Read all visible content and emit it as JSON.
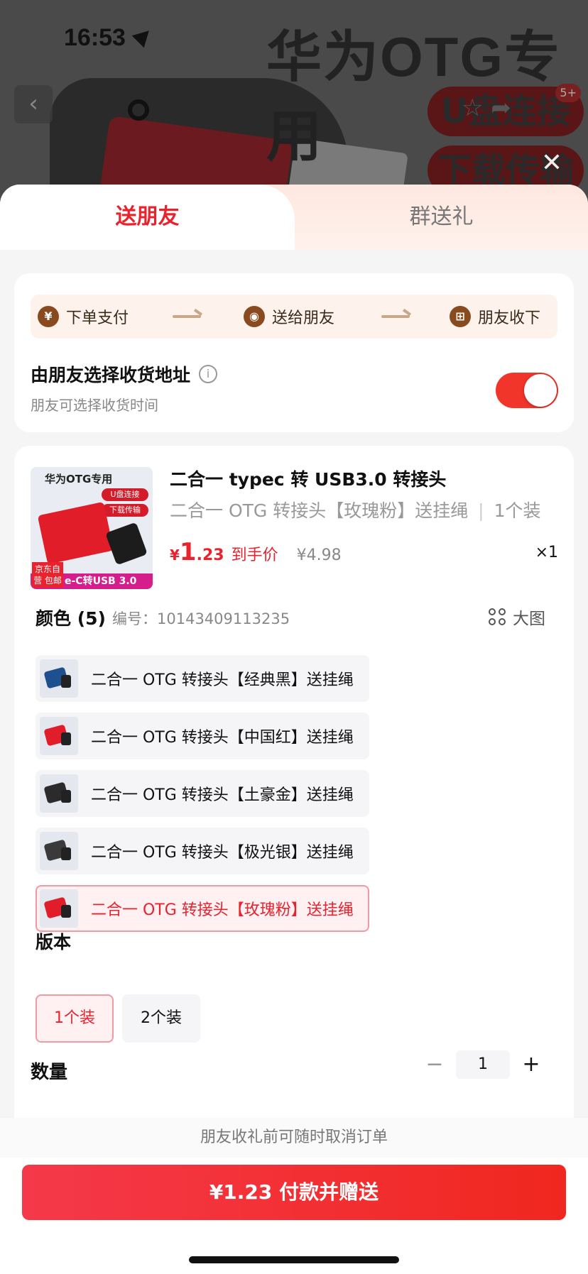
{
  "status_bar": {
    "time": "16:53"
  },
  "background": {
    "title": "华为OTG专用",
    "tags": [
      "U盘连接",
      "下载传输"
    ],
    "badge": "5+"
  },
  "tabs": [
    {
      "label": "送朋友",
      "active": true
    },
    {
      "label": "群送礼",
      "active": false
    }
  ],
  "steps": [
    {
      "label": "下单支付",
      "icon": "yen-icon"
    },
    {
      "label": "送给朋友",
      "icon": "wechat-icon"
    },
    {
      "label": "朋友收下",
      "icon": "gift-icon"
    }
  ],
  "address": {
    "title": "由朋友选择收货地址",
    "subtitle": "朋友可选择收货时间",
    "toggle_on": true
  },
  "product": {
    "thumb_title": "华为OTG专用",
    "thumb_tag1": "U盘连接",
    "thumb_tag2": "下载传输",
    "thumb_bar": "e-C转USB 3.0",
    "thumb_corner": "京东自营 包邮",
    "title": "二合一 typec 转 USB3.0 转接头",
    "variant": "二合一 OTG 转接头【玫瑰粉】送挂绳",
    "variant_pack": "1个装",
    "price_currency": "¥",
    "price_int": "1",
    "price_dec": ".23",
    "price_label": "到手价",
    "original_price": "¥4.98",
    "quantity_label": "×1"
  },
  "color": {
    "heading": "颜色 (5)",
    "code": "编号：10143409113235",
    "big_image_label": "大图",
    "options": [
      {
        "label": "二合一 OTG 转接头【经典黑】送挂绳",
        "selected": false,
        "swatch": "#1e4f8f"
      },
      {
        "label": "二合一 OTG 转接头【中国红】送挂绳",
        "selected": false,
        "swatch": "#e11d2a"
      },
      {
        "label": "二合一 OTG 转接头【土豪金】送挂绳",
        "selected": false,
        "swatch": "#2b2b2b"
      },
      {
        "label": "二合一 OTG 转接头【极光银】送挂绳",
        "selected": false,
        "swatch": "#3a3a3a"
      },
      {
        "label": "二合一 OTG 转接头【玫瑰粉】送挂绳",
        "selected": true,
        "swatch": "#e11d2a"
      }
    ]
  },
  "version": {
    "heading": "版本",
    "options": [
      {
        "label": "1个装",
        "selected": true
      },
      {
        "label": "2个装",
        "selected": false
      }
    ]
  },
  "quantity": {
    "heading": "数量",
    "minus": "−",
    "value": "1",
    "plus": "+"
  },
  "footer": {
    "note": "朋友收礼前可随时取消订单",
    "pay_button": "¥1.23 付款并赠送"
  },
  "colors": {
    "accent": "#e8232e",
    "toggle": "#f1352a",
    "step_icon": "#8a4a1f"
  }
}
